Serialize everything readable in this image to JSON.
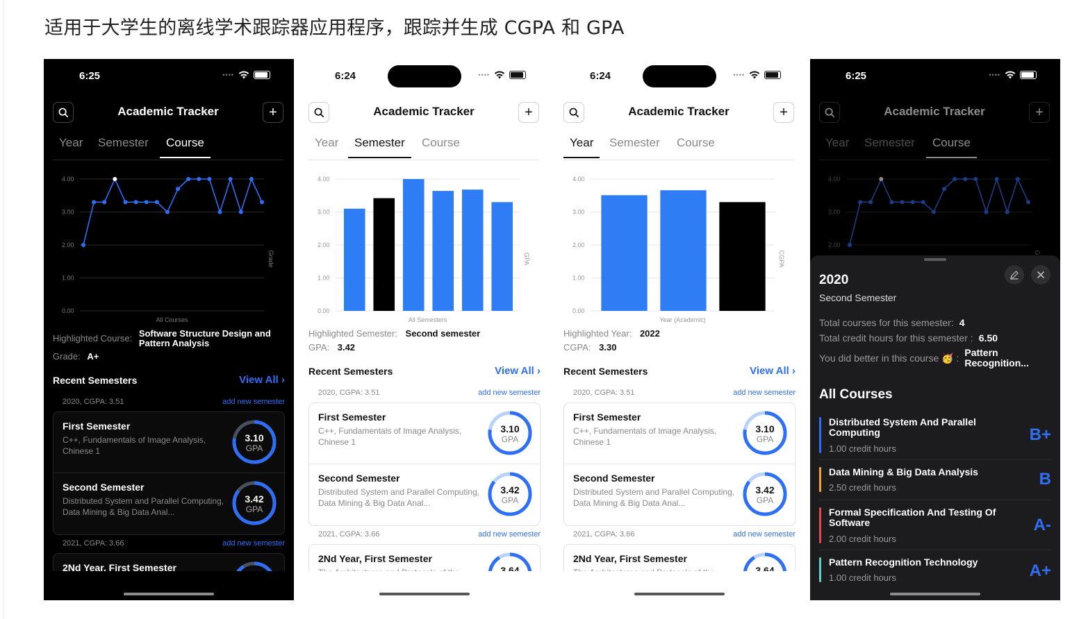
{
  "page_title": "适用于大学生的离线学术跟踪器应用程序，跟踪并生成 CGPA 和 GPA",
  "common": {
    "app_title": "Academic Tracker",
    "tabs": [
      "Year",
      "Semester",
      "Course"
    ],
    "recent_semesters": "Recent Semesters",
    "view_all": "View All",
    "add_new_semester": "add new semester",
    "ring_label": "GPA",
    "group_2020": "2020, CGPA: 3.51",
    "group_2021": "2021, CGPA: 3.66",
    "first_semester": "First Semester",
    "first_semester_desc": "C++, Fundamentals of Image Analysis, Chinese 1",
    "first_semester_gpa": "3.10",
    "second_semester": "Second Semester",
    "second_semester_desc": "Distributed System and Parallel Computing, Data Mining & Big Data Anal...",
    "second_semester_gpa": "3.42",
    "third_semester": "2Nd Year, First Semester",
    "third_semester_desc": "The Architectures and Protocols of the",
    "third_semester_gpa": "3.64"
  },
  "phone1": {
    "time": "6:25",
    "highlight_key": "Highlighted Course:",
    "highlight_val": "Software Structure Design and Pattern Analysis",
    "grade_key": "Grade:",
    "grade_val": "A+"
  },
  "phone2": {
    "time": "6:24",
    "highlight_key": "Highlighted Semester:",
    "highlight_val": "Second semester",
    "gpa_key": "GPA:",
    "gpa_val": "3.42"
  },
  "phone3": {
    "time": "6:24",
    "highlight_key": "Highlighted Year:",
    "highlight_val": "2022",
    "cgpa_key": "CGPA:",
    "cgpa_val": "3.30"
  },
  "phone4": {
    "time": "6:25",
    "sheet": {
      "year": "2020",
      "semester": "Second Semester",
      "total_courses_label": "Total courses for this semester:",
      "total_courses": "4",
      "total_hours_label": "Total credit hours for this semester :",
      "total_hours": "6.50",
      "better_label": "You did better in this course 🥳 :",
      "better_course": "Pattern Recognition...",
      "all_courses": "All Courses",
      "courses": [
        {
          "name": "Distributed System And Parallel Computing",
          "hours": "1.00 credit hours",
          "grade": "B+",
          "color": "#2f6ff5"
        },
        {
          "name": "Data Mining & Big Data Analysis",
          "hours": "2.50 credit hours",
          "grade": "B",
          "color": "#f2a33a"
        },
        {
          "name": "Formal Specification And Testing Of Software",
          "hours": "2.00 credit hours",
          "grade": "A-",
          "color": "#e5484d"
        },
        {
          "name": "Pattern Recognition Technology",
          "hours": "1.00 credit hours",
          "grade": "A+",
          "color": "#5fd0c8"
        }
      ]
    }
  },
  "colors": {
    "accent": "#2f6ff5",
    "ring_track": "#b9d2fb",
    "highlight_bar_light": "#000000",
    "highlight_point_dark": "#ffffff"
  },
  "chart_data": [
    {
      "type": "line",
      "title": "",
      "xlabel": "All Courses",
      "ylabel": "Grade",
      "ylim": [
        0,
        4
      ],
      "y_ticks": [
        "0.00",
        "1.00",
        "2.00",
        "3.00",
        "4.00"
      ],
      "values": [
        2.0,
        3.3,
        3.3,
        4.0,
        3.3,
        3.3,
        3.3,
        3.3,
        3.0,
        3.7,
        4.0,
        4.0,
        4.0,
        3.0,
        4.0,
        3.0,
        4.0,
        3.3
      ],
      "highlight_index": 3,
      "grid": true
    },
    {
      "type": "bar",
      "title": "",
      "xlabel": "All Semesters",
      "ylabel": "GPA",
      "ylim": [
        0,
        4
      ],
      "y_ticks": [
        "0.00",
        "1.00",
        "2.00",
        "3.00",
        "4.00"
      ],
      "values": [
        3.1,
        3.42,
        4.0,
        3.64,
        3.68,
        3.3
      ],
      "highlight_index": 1,
      "grid": true
    },
    {
      "type": "bar",
      "title": "",
      "xlabel": "Year (Academic)",
      "ylabel": "CGPA",
      "ylim": [
        0,
        4
      ],
      "y_ticks": [
        "0.00",
        "1.00",
        "2.00",
        "3.00",
        "4.00"
      ],
      "values": [
        3.51,
        3.66,
        3.3
      ],
      "highlight_index": 2,
      "grid": true
    }
  ]
}
